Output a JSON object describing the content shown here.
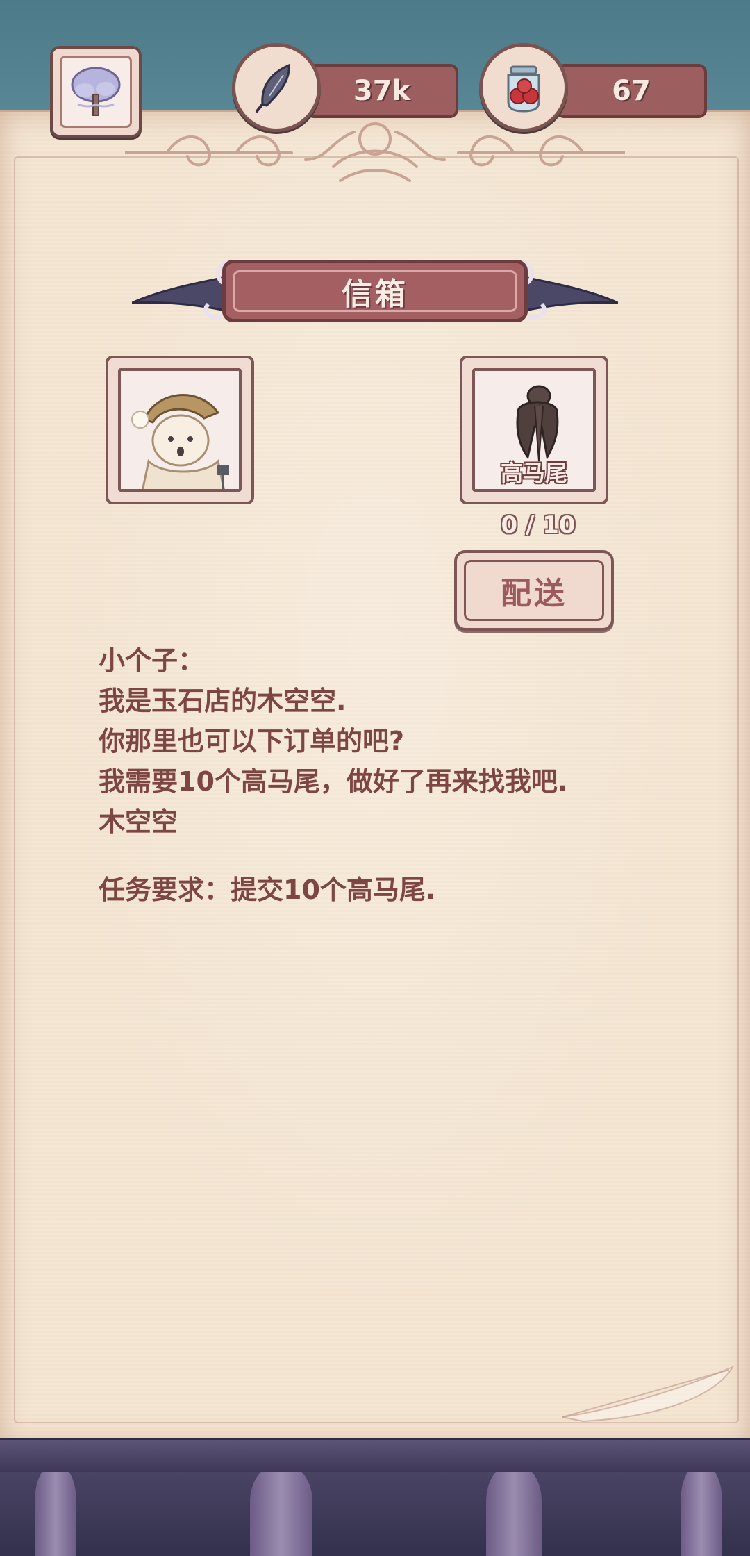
{
  "resources": {
    "feathers": "37k",
    "berries": "67"
  },
  "mailbox": {
    "title": "信箱"
  },
  "order": {
    "item_name": "高马尾",
    "progress": "0 / 10",
    "deliver_label": "配送"
  },
  "letter": {
    "greeting": "小个子：",
    "lines": [
      "我是玉石店的木空空.",
      "你那里也可以下订单的吧?",
      "我需要10个高马尾，做好了再来找我吧.",
      "木空空"
    ],
    "requirement": "任务要求：提交10个高马尾."
  }
}
